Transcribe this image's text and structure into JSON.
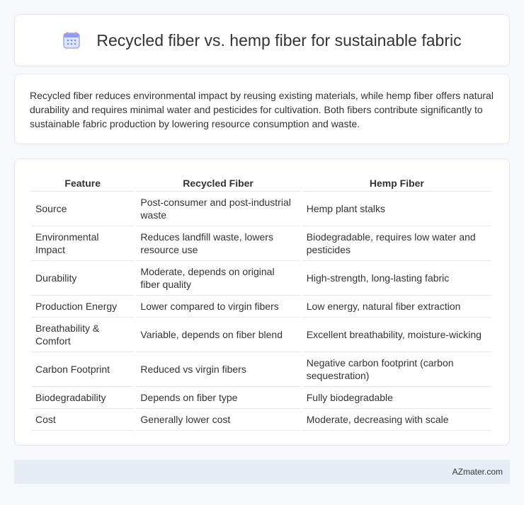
{
  "header": {
    "icon": "calendar-icon",
    "title": "Recycled fiber vs. hemp fiber for sustainable fabric"
  },
  "summary": "Recycled fiber reduces environmental impact by reusing existing materials, while hemp fiber offers natural durability and requires minimal water and pesticides for cultivation. Both fibers contribute significantly to sustainable fabric production by lowering resource consumption and waste.",
  "table": {
    "headers": [
      "Feature",
      "Recycled Fiber",
      "Hemp Fiber"
    ],
    "rows": [
      [
        "Source",
        "Post-consumer and post-industrial waste",
        "Hemp plant stalks"
      ],
      [
        "Environmental Impact",
        "Reduces landfill waste, lowers resource use",
        "Biodegradable, requires low water and pesticides"
      ],
      [
        "Durability",
        "Moderate, depends on original fiber quality",
        "High-strength, long-lasting fabric"
      ],
      [
        "Production Energy",
        "Lower compared to virgin fibers",
        "Low energy, natural fiber extraction"
      ],
      [
        "Breathability & Comfort",
        "Variable, depends on fiber blend",
        "Excellent breathability, moisture-wicking"
      ],
      [
        "Carbon Footprint",
        "Reduced vs virgin fibers",
        "Negative carbon footprint (carbon sequestration)"
      ],
      [
        "Biodegradability",
        "Depends on fiber type",
        "Fully biodegradable"
      ],
      [
        "Cost",
        "Generally lower cost",
        "Moderate, decreasing with scale"
      ]
    ]
  },
  "footer": {
    "site": "AZmater.com"
  },
  "colors": {
    "background": "#f7f8fc",
    "footer": "#e8ecf7",
    "icon_accent": "#7b8cf0",
    "icon_top": "#f08aa0"
  }
}
